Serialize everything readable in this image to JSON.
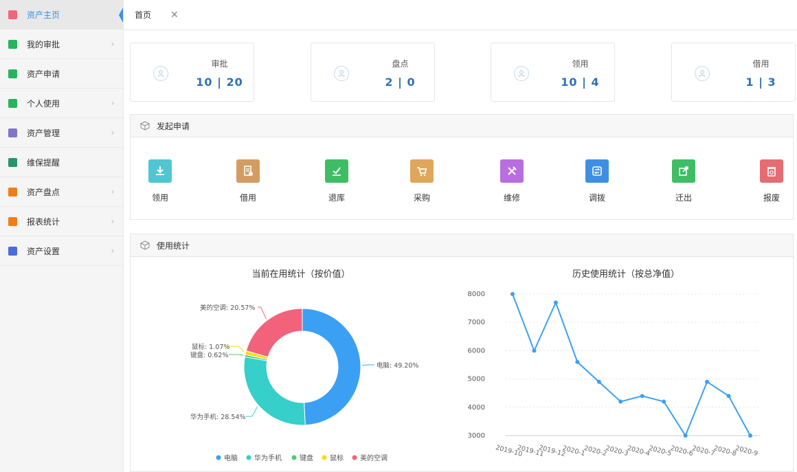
{
  "sidebar": {
    "items": [
      {
        "label": "资产主页",
        "color": "#f1667a",
        "active": true
      },
      {
        "label": "我的审批",
        "color": "#27b45c",
        "chevron": true
      },
      {
        "label": "资产申请",
        "color": "#27b45c"
      },
      {
        "label": "个人使用",
        "color": "#27b45c",
        "chevron": true
      },
      {
        "label": "资产管理",
        "color": "#8077c8",
        "chevron": true
      },
      {
        "label": "维保提醒",
        "color": "#26966a"
      },
      {
        "label": "资产盘点",
        "color": "#f07d1c",
        "chevron": true
      },
      {
        "label": "报表统计",
        "color": "#f07d1c",
        "chevron": true
      },
      {
        "label": "资产设置",
        "color": "#4a6dd8",
        "chevron": true
      }
    ]
  },
  "tab": {
    "label": "首页",
    "close": "✕"
  },
  "stats": [
    {
      "title": "审批",
      "value": "10 | 20"
    },
    {
      "title": "盘点",
      "value": "2 | 0"
    },
    {
      "title": "领用",
      "value": "10 | 4"
    },
    {
      "title": "借用",
      "value": "1 | 3"
    }
  ],
  "apply_panel": {
    "title": "发起申请"
  },
  "actions": [
    {
      "label": "领用",
      "color": "#4fc6d1",
      "icon": "download-icon"
    },
    {
      "label": "借用",
      "color": "#d59c62",
      "icon": "document-icon"
    },
    {
      "label": "退库",
      "color": "#3fbd64",
      "icon": "check-icon"
    },
    {
      "label": "采购",
      "color": "#e0a65a",
      "icon": "cart-icon"
    },
    {
      "label": "维修",
      "color": "#b86ee0",
      "icon": "tools-icon"
    },
    {
      "label": "调拨",
      "color": "#3f8fe0",
      "icon": "transfer-icon"
    },
    {
      "label": "迁出",
      "color": "#3fbd64",
      "icon": "export-icon"
    },
    {
      "label": "报废",
      "color": "#e66c73",
      "icon": "trash-icon"
    }
  ],
  "usage_panel": {
    "title": "使用统计"
  },
  "chart_data": [
    {
      "type": "pie",
      "title": "当前在用统计（按价值）",
      "slices": [
        {
          "name": "电脑",
          "percent": 49.2,
          "label": "电脑: 49.20%",
          "color": "#3ba0f3"
        },
        {
          "name": "华为手机",
          "percent": 28.54,
          "label": "华为手机: 28.54%",
          "color": "#36cfc9"
        },
        {
          "name": "键盘",
          "percent": 0.62,
          "label": "键盘: 0.62%",
          "color": "#4cca73"
        },
        {
          "name": "鼠标",
          "percent": 1.07,
          "label": "鼠标: 1.07%",
          "color": "#fadb14"
        },
        {
          "name": "美的空调",
          "percent": 20.57,
          "label": "美的空调: 20.57%",
          "color": "#f2637b"
        }
      ],
      "legend_position": "bottom"
    },
    {
      "type": "line",
      "title": "历史使用统计（按总净值）",
      "x": [
        "2019-10",
        "2019-11",
        "2019-12",
        "2020-1",
        "2020-2",
        "2020-3",
        "2020-4",
        "2020-5",
        "2020-6",
        "2020-7",
        "2020-8",
        "2020-9"
      ],
      "values": [
        8000,
        6000,
        7700,
        5600,
        4900,
        4200,
        4400,
        4200,
        3000,
        4900,
        4400,
        3000
      ],
      "y_ticks": [
        "8000",
        "7000",
        "6000",
        "5000",
        "4000",
        "3000"
      ],
      "ylim": [
        3000,
        8000
      ],
      "color": "#3ba0f3",
      "grid": true
    }
  ]
}
